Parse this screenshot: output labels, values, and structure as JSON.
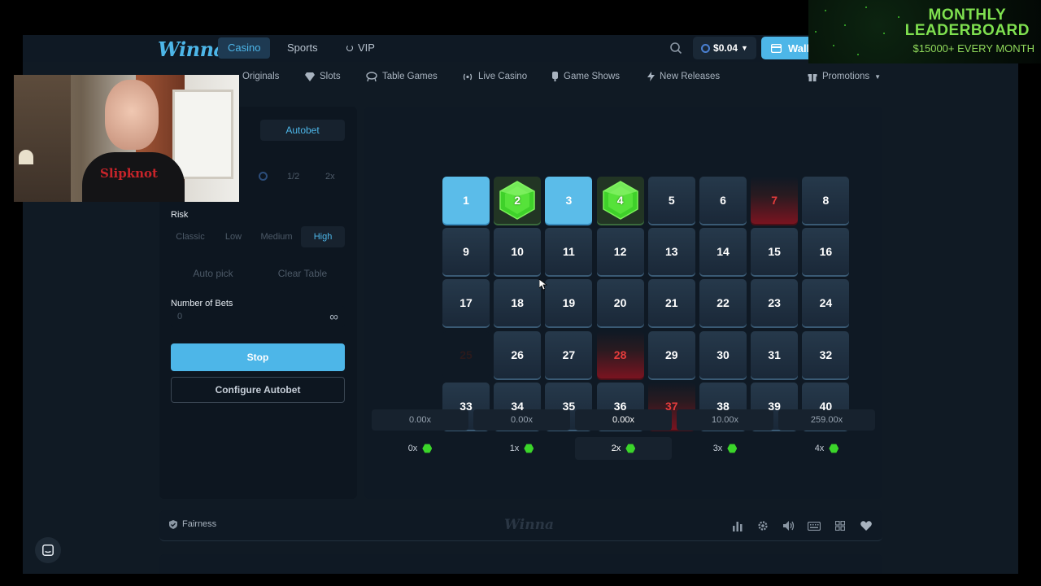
{
  "topnav": {
    "logo": "Winna",
    "tabs": [
      "Casino",
      "Sports",
      "VIP"
    ],
    "active_tab": "Casino",
    "balance": "$0.04",
    "wallet_label": "Wall"
  },
  "subnav": {
    "items": [
      "Originals",
      "Slots",
      "Table Games",
      "Live Casino",
      "Game Shows",
      "New Releases"
    ],
    "promotions": "Promotions"
  },
  "panel": {
    "autobet_tab": "Autobet",
    "half_label": "1/2",
    "double_label": "2x",
    "risk_label": "Risk",
    "risk_options": [
      "Classic",
      "Low",
      "Medium",
      "High"
    ],
    "risk_selected": "High",
    "auto_pick": "Auto pick",
    "clear_table": "Clear Table",
    "number_of_bets_label": "Number of Bets",
    "number_of_bets_value": "0",
    "infinity_icon": "∞",
    "stop_label": "Stop",
    "configure_label": "Configure Autobet"
  },
  "board": {
    "tiles": [
      {
        "n": "1",
        "state": "selected"
      },
      {
        "n": "2",
        "state": "gem"
      },
      {
        "n": "3",
        "state": "selected"
      },
      {
        "n": "4",
        "state": "gem"
      },
      {
        "n": "5",
        "state": "normal"
      },
      {
        "n": "6",
        "state": "normal"
      },
      {
        "n": "7",
        "state": "loss"
      },
      {
        "n": "8",
        "state": "normal"
      },
      {
        "n": "9",
        "state": "normal"
      },
      {
        "n": "10",
        "state": "normal"
      },
      {
        "n": "11",
        "state": "normal"
      },
      {
        "n": "12",
        "state": "normal"
      },
      {
        "n": "13",
        "state": "normal"
      },
      {
        "n": "14",
        "state": "normal"
      },
      {
        "n": "15",
        "state": "normal"
      },
      {
        "n": "16",
        "state": "normal"
      },
      {
        "n": "17",
        "state": "normal"
      },
      {
        "n": "18",
        "state": "normal"
      },
      {
        "n": "19",
        "state": "normal"
      },
      {
        "n": "20",
        "state": "normal"
      },
      {
        "n": "21",
        "state": "normal"
      },
      {
        "n": "22",
        "state": "normal"
      },
      {
        "n": "23",
        "state": "normal"
      },
      {
        "n": "24",
        "state": "normal"
      },
      {
        "n": "25",
        "state": "hidden"
      },
      {
        "n": "26",
        "state": "normal"
      },
      {
        "n": "27",
        "state": "normal"
      },
      {
        "n": "28",
        "state": "loss"
      },
      {
        "n": "29",
        "state": "normal"
      },
      {
        "n": "30",
        "state": "normal"
      },
      {
        "n": "31",
        "state": "normal"
      },
      {
        "n": "32",
        "state": "normal"
      },
      {
        "n": "33",
        "state": "normal"
      },
      {
        "n": "34",
        "state": "normal"
      },
      {
        "n": "35",
        "state": "normal"
      },
      {
        "n": "36",
        "state": "normal"
      },
      {
        "n": "37",
        "state": "loss"
      },
      {
        "n": "38",
        "state": "normal"
      },
      {
        "n": "39",
        "state": "normal"
      },
      {
        "n": "40",
        "state": "normal"
      }
    ],
    "multipliers": [
      "0.00x",
      "0.00x",
      "0.00x",
      "10.00x",
      "259.00x"
    ],
    "hits": [
      "0x",
      "1x",
      "2x",
      "3x",
      "4x"
    ],
    "current_index": 2
  },
  "footer": {
    "fairness": "Fairness",
    "logo": "Winna"
  },
  "overlay": {
    "leaderboard_title_1": "MONTHLY",
    "leaderboard_title_2": "LEADERBOARD",
    "leaderboard_sub": "$15000+ EVERY MONTH",
    "shirt_text": "Slipknot"
  },
  "colors": {
    "accent": "#4db6e8",
    "gem_green": "#3bd52a",
    "loss_red": "#e53c3c",
    "background": "#101a24"
  }
}
